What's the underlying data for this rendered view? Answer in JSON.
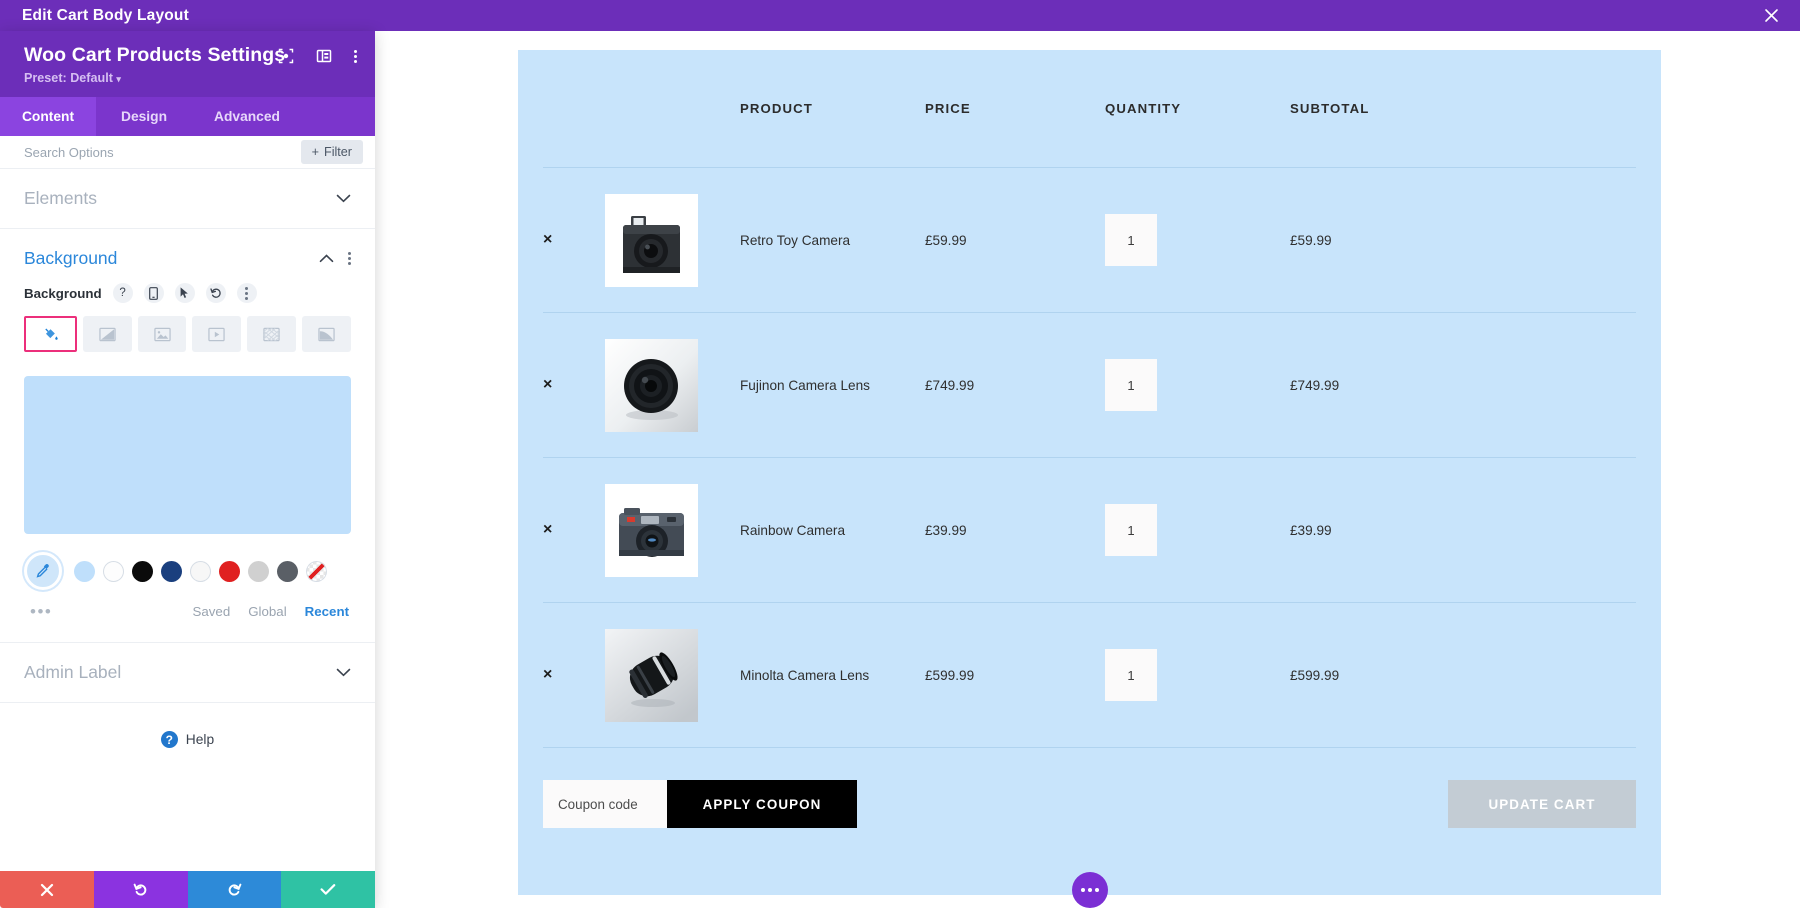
{
  "topbar": {
    "title": "Edit Cart Body Layout",
    "close_icon": "close-icon"
  },
  "panel": {
    "header": {
      "title": "Woo Cart Products Settings",
      "preset": "Preset: Default",
      "icons": [
        "focus-icon",
        "layout-icon",
        "kebab-icon"
      ]
    },
    "tabs": [
      {
        "label": "Content",
        "active": true
      },
      {
        "label": "Design",
        "active": false
      },
      {
        "label": "Advanced",
        "active": false
      }
    ],
    "search": {
      "placeholder": "Search Options",
      "value": "",
      "filter_label": "Filter"
    },
    "sections": [
      {
        "label": "Elements",
        "open": false
      },
      {
        "label": "Background",
        "open": true
      },
      {
        "label": "Admin Label",
        "open": false
      }
    ],
    "background": {
      "field_label": "Background",
      "field_icons": [
        "help-icon",
        "responsive-icon",
        "hover-icon",
        "reset-icon",
        "kebab-icon"
      ],
      "types": [
        {
          "name": "background-color-icon",
          "selected": true
        },
        {
          "name": "background-gradient-icon",
          "selected": false
        },
        {
          "name": "background-image-icon",
          "selected": false
        },
        {
          "name": "background-video-icon",
          "selected": false
        },
        {
          "name": "background-pattern-icon",
          "selected": false
        },
        {
          "name": "background-mask-icon",
          "selected": false
        }
      ],
      "preview_color": "#bfdffb",
      "swatches": [
        "#bfdffb",
        "#fdfdfd",
        "#0b0b0b",
        "#1a3f7e",
        "#f7f7f7",
        "#e02020",
        "#d0d0d0",
        "#5a5f66",
        "transparent"
      ],
      "sub_tabs": [
        {
          "label": "Saved",
          "active": false
        },
        {
          "label": "Global",
          "active": false
        },
        {
          "label": "Recent",
          "active": true
        }
      ],
      "more_dots": "•••"
    },
    "help": {
      "label": "Help",
      "badge": "?"
    },
    "footer": [
      {
        "name": "cancel-button",
        "icon": "✕",
        "color": "#eb5e55"
      },
      {
        "name": "undo-button",
        "icon": "↺",
        "color": "#8b33e0"
      },
      {
        "name": "redo-button",
        "icon": "↻",
        "color": "#2d8ad8"
      },
      {
        "name": "save-button",
        "icon": "✓",
        "color": "#2fc2a4"
      }
    ]
  },
  "cart": {
    "background_color": "#c8e4fb",
    "columns": [
      "",
      "",
      "PRODUCT",
      "PRICE",
      "QUANTITY",
      "SUBTOTAL"
    ],
    "headers": {
      "product": "PRODUCT",
      "price": "PRICE",
      "quantity": "QUANTITY",
      "subtotal": "SUBTOTAL"
    },
    "rows": [
      {
        "remove": "×",
        "image": "retro-toy-camera-thumbnail",
        "name": "Retro Toy Camera",
        "price": "£59.99",
        "quantity": "1",
        "subtotal": "£59.99"
      },
      {
        "remove": "×",
        "image": "fujinon-camera-lens-thumbnail",
        "name": "Fujinon Camera Lens",
        "price": "£749.99",
        "quantity": "1",
        "subtotal": "£749.99"
      },
      {
        "remove": "×",
        "image": "rainbow-camera-thumbnail",
        "name": "Rainbow Camera",
        "price": "£39.99",
        "quantity": "1",
        "subtotal": "£39.99"
      },
      {
        "remove": "×",
        "image": "minolta-camera-lens-thumbnail",
        "name": "Minolta Camera Lens",
        "price": "£599.99",
        "quantity": "1",
        "subtotal": "£599.99"
      }
    ],
    "coupon": {
      "placeholder": "Coupon code",
      "value": "",
      "apply_label": "APPLY COUPON"
    },
    "update_label": "UPDATE CART",
    "fab": "more-options-icon"
  }
}
